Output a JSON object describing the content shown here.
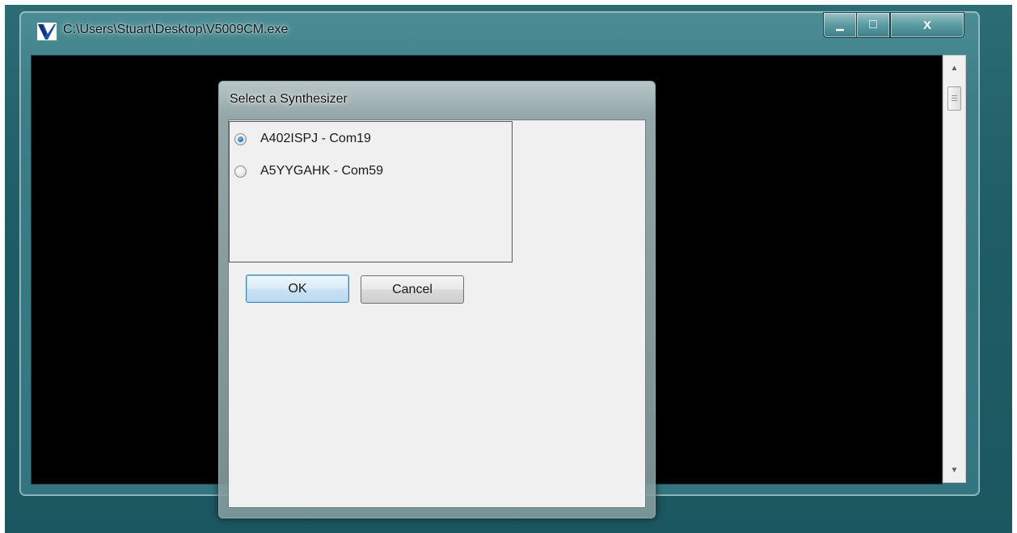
{
  "window": {
    "title": "C:\\Users\\Stuart\\Desktop\\V5009CM.exe",
    "caption": {
      "minimize_glyph": "▁",
      "maximize_glyph": "□",
      "close_glyph": "X"
    }
  },
  "scrollbar": {
    "up_glyph": "▲",
    "down_glyph": "▼"
  },
  "dialog": {
    "title": "Select a Synthesizer",
    "options": [
      {
        "label": "A402ISPJ - Com19",
        "checked": true
      },
      {
        "label": "A5YYGAHK - Com59",
        "checked": false
      }
    ],
    "ok_label": "OK",
    "cancel_label": "Cancel"
  },
  "colors": {
    "desktop": "#1f5d66",
    "console_background": "#000000",
    "dialog_client": "#f0f0f0",
    "focused_button_border": "#3c7fb1"
  }
}
